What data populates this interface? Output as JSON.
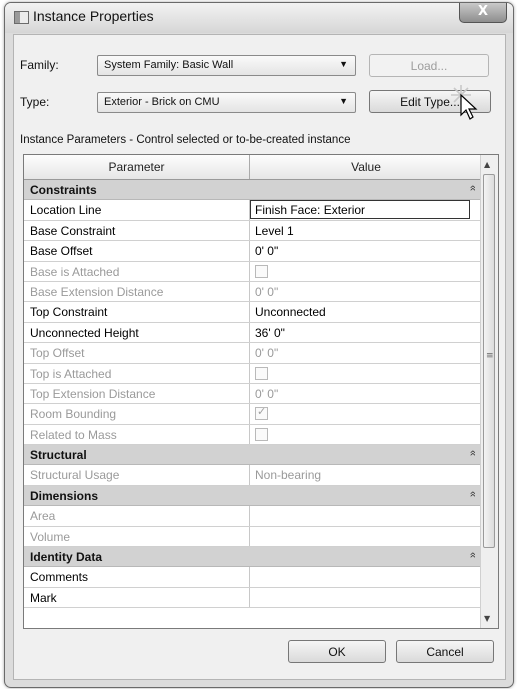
{
  "window": {
    "title": "Instance Properties",
    "close_label": "X"
  },
  "family": {
    "label": "Family:",
    "value": "System Family: Basic Wall"
  },
  "type": {
    "label": "Type:",
    "value": "Exterior - Brick on CMU"
  },
  "buttons": {
    "load": "Load...",
    "edit_type": "Edit Type...",
    "ok": "OK",
    "cancel": "Cancel"
  },
  "instance_params_label": "Instance Parameters - Control selected or to-be-created instance",
  "columns": {
    "parameter": "Parameter",
    "value": "Value"
  },
  "rows": [
    {
      "kind": "group",
      "label": "Constraints"
    },
    {
      "label": "Location Line",
      "value": "Finish Face: Exterior",
      "selected": true
    },
    {
      "label": "Base Constraint",
      "value": "Level 1"
    },
    {
      "label": "Base Offset",
      "value": "0'  0\""
    },
    {
      "label": "Base is Attached",
      "checkbox": false,
      "dim": true
    },
    {
      "label": "Base Extension Distance",
      "value": "0'  0\"",
      "dim": true
    },
    {
      "label": "Top Constraint",
      "value": "Unconnected"
    },
    {
      "label": "Unconnected Height",
      "value": "36'  0\""
    },
    {
      "label": "Top Offset",
      "value": "0'  0\"",
      "dim": true
    },
    {
      "label": "Top is Attached",
      "checkbox": false,
      "dim": true
    },
    {
      "label": "Top Extension Distance",
      "value": "0'  0\"",
      "dim": true
    },
    {
      "label": "Room Bounding",
      "checkbox": true,
      "dim": true
    },
    {
      "label": "Related to Mass",
      "checkbox": false,
      "dim": true
    },
    {
      "kind": "group",
      "label": "Structural"
    },
    {
      "label": "Structural Usage",
      "value": "Non-bearing",
      "dim": true
    },
    {
      "kind": "group",
      "label": "Dimensions"
    },
    {
      "label": "Area",
      "value": "",
      "dim": true
    },
    {
      "label": "Volume",
      "value": "",
      "dim": true
    },
    {
      "kind": "group",
      "label": "Identity Data"
    },
    {
      "label": "Comments",
      "value": ""
    },
    {
      "label": "Mark",
      "value": ""
    }
  ],
  "icons": {
    "collapse": "double-chevron-up",
    "combo_arrow": "triangle-down"
  }
}
